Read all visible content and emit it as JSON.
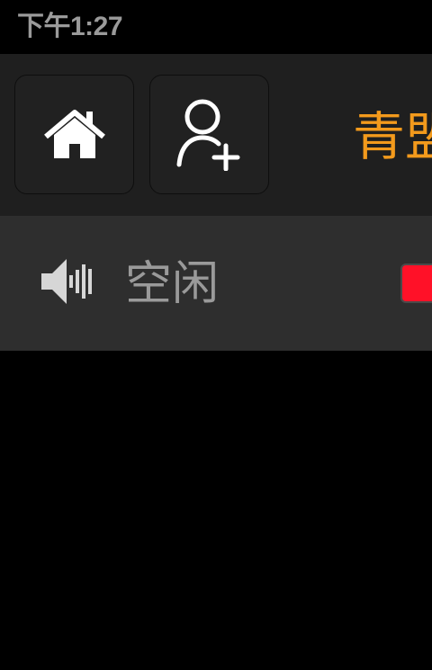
{
  "status_bar": {
    "time": "下午1:27"
  },
  "toolbar": {
    "home_icon": "home-icon",
    "add_user_icon": "add-user-icon",
    "title": "青盟",
    "title_color": "#f39a1c"
  },
  "status_row": {
    "speaker_icon": "speaker-icon",
    "label": "空闲",
    "indicator_color": "#ff1128"
  }
}
